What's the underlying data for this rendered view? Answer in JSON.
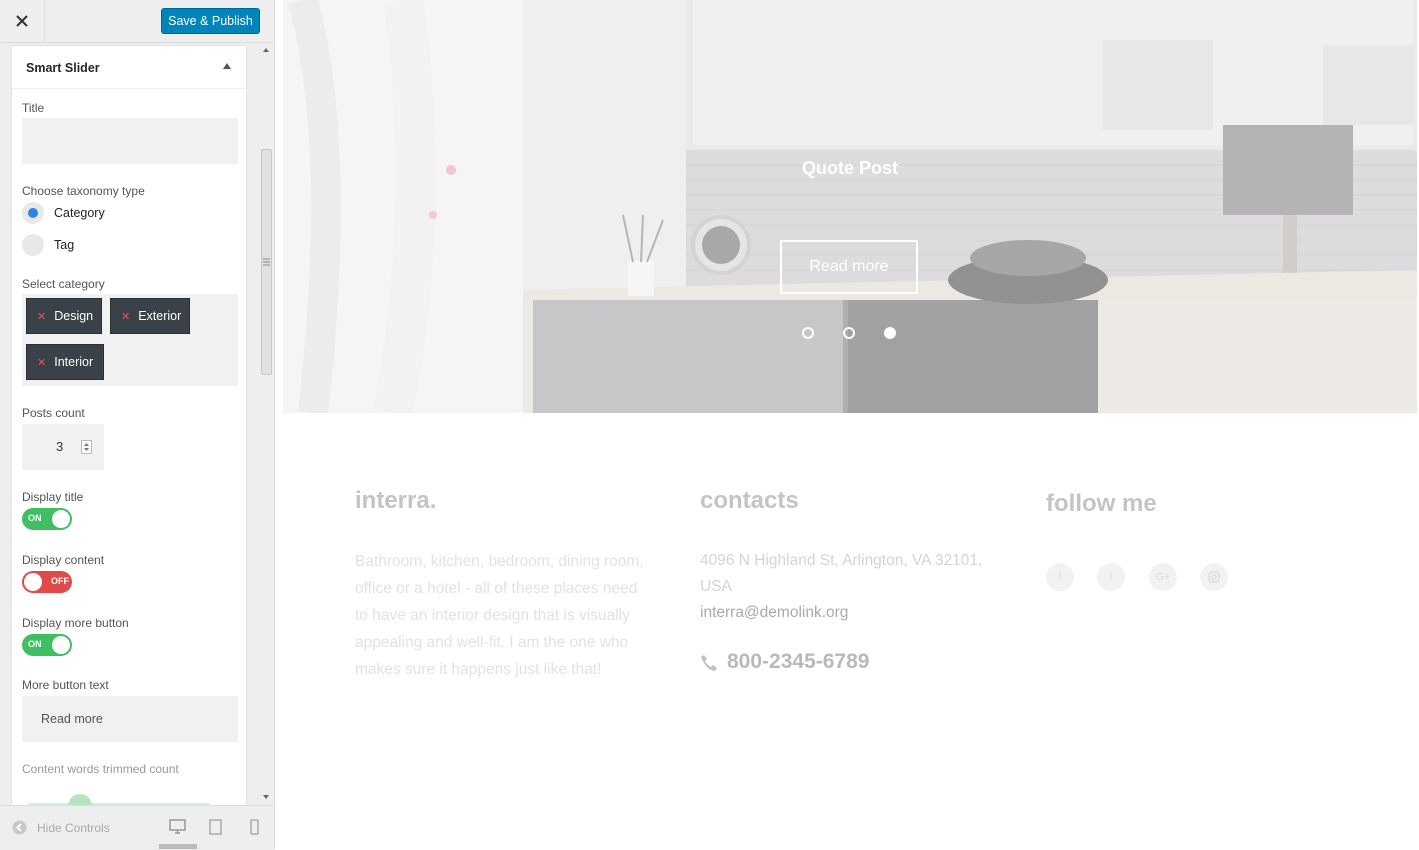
{
  "topbar": {
    "close": "✕",
    "save_label": "Save & Publish"
  },
  "section": {
    "title": "Smart Slider",
    "title_label": "Title",
    "title_value": "",
    "taxonomy_label": "Choose taxonomy type",
    "taxonomy_options": [
      "Category",
      "Tag"
    ],
    "taxonomy_selected": "Category",
    "category_label": "Select category",
    "categories": [
      "Design",
      "Exterior",
      "Interior"
    ],
    "posts_count_label": "Posts count",
    "posts_count": "3",
    "display_title_label": "Display title",
    "display_title": "ON",
    "display_content_label": "Display content",
    "display_content": "OFF",
    "display_more_label": "Display more button",
    "display_more": "ON",
    "more_text_label": "More button text",
    "more_text_value": "Read more",
    "trim_label": "Content words trimmed count"
  },
  "footer_bar": {
    "hide_controls": "Hide Controls"
  },
  "slider": {
    "title": "Quote Post",
    "button": "Read more",
    "dots": 3,
    "active_dot": 3
  },
  "footer": {
    "brand": "interra.",
    "about": "Bathroom, kitchen, bedroom, dining room, office or a hotel - all of these places need to have an interior design that is visually appealing and well-fit. I am the one who makes sure it happens just like that!",
    "contacts_title": "contacts",
    "address": "4096 N Highland St, Arlington, VA 32101, USA",
    "email": "interra@demolink.org",
    "phone": "800-2345-6789",
    "follow_title": "follow me",
    "social": [
      "facebook-icon",
      "twitter-icon",
      "google-plus-icon",
      "instagram-icon"
    ]
  },
  "colors": {
    "primary": "#0085ba",
    "toggle_on": "#3fbe62",
    "toggle_off": "#e04a4a",
    "chip": "#3a4148"
  }
}
